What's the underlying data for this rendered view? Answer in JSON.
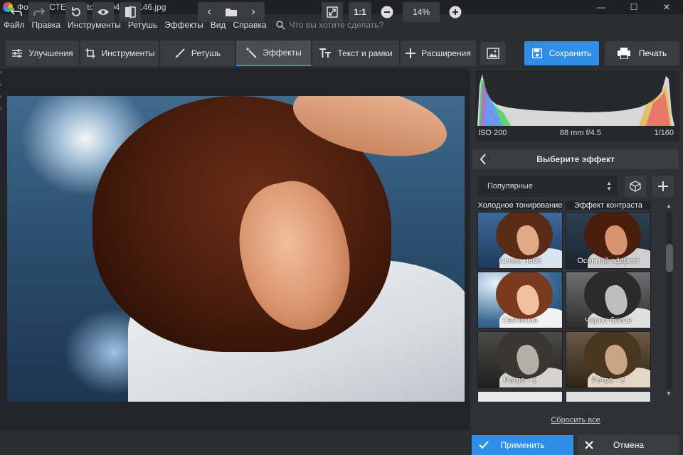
{
  "window": {
    "title": "ФотоМАСТЕР - iStock-1044871146.jpg",
    "controls": [
      "—",
      "☐",
      "✕"
    ]
  },
  "menu": {
    "items": [
      "Файл",
      "Правка",
      "Инструменты",
      "Ретушь",
      "Эффекты",
      "Вид",
      "Справка"
    ],
    "search_placeholder": "Что вы хотите сделать?"
  },
  "tabs": [
    {
      "label": "Улучшения",
      "icon": "sliders-icon"
    },
    {
      "label": "Инструменты",
      "icon": "crop-icon"
    },
    {
      "label": "Ретушь",
      "icon": "brush-icon"
    },
    {
      "label": "Эффекты",
      "icon": "magic-wand-icon",
      "active": true
    },
    {
      "label": "Текст и рамки",
      "icon": "text-icon"
    },
    {
      "label": "Расширения",
      "icon": "plus-icon"
    }
  ],
  "actions": {
    "save": "Сохранить",
    "print": "Печать"
  },
  "photo_info": {
    "iso": "ISO 200",
    "lens": "88 mm f/4.5",
    "shutter": "1/160"
  },
  "effects": {
    "title": "Выберите эффект",
    "category": "Популярные",
    "top_captions": [
      "Холодное тонирование",
      "Эффект контраста"
    ],
    "items": [
      {
        "label": "Синее небо",
        "style": "blue"
      },
      {
        "label": "Осенний эффект",
        "style": "autumn"
      },
      {
        "label": "Свечение",
        "style": "glow"
      },
      {
        "label": "Чёрно-белое",
        "style": "bw"
      },
      {
        "label": "Ретро - 1",
        "style": "retro1"
      },
      {
        "label": "Ретро - 2",
        "style": "retro2"
      }
    ],
    "reset": "Сбросить все"
  },
  "bottom": {
    "ratio": "1:1",
    "zoom": "14%"
  },
  "footer": {
    "apply": "Применить",
    "cancel": "Отмена"
  },
  "colors": {
    "accent": "#2f8ee8",
    "panel": "#2f3136",
    "workspace": "#22242a"
  }
}
